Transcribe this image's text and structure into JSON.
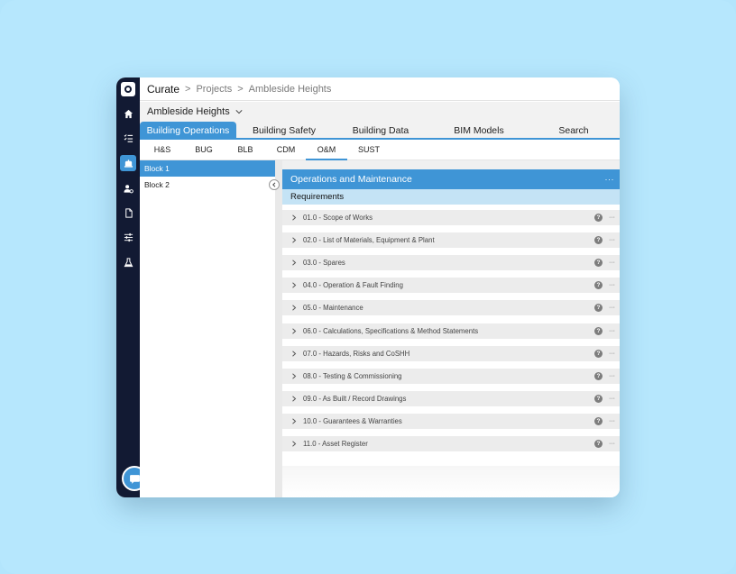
{
  "breadcrumb": {
    "app": "Curate",
    "separator": ">",
    "items": [
      "Projects",
      "Ambleside Heights"
    ]
  },
  "project": {
    "name": "Ambleside Heights"
  },
  "main_tabs": [
    {
      "label": "Building Operations",
      "active": true
    },
    {
      "label": "Building Safety",
      "active": false
    },
    {
      "label": "Building Data",
      "active": false
    },
    {
      "label": "BIM Models",
      "active": false
    },
    {
      "label": "Search",
      "active": false
    }
  ],
  "sub_tabs": [
    {
      "label": "H&S",
      "active": false
    },
    {
      "label": "BUG",
      "active": false
    },
    {
      "label": "BLB",
      "active": false
    },
    {
      "label": "CDM",
      "active": false
    },
    {
      "label": "O&M",
      "active": true
    },
    {
      "label": "SUST",
      "active": false
    }
  ],
  "blocks": [
    {
      "label": "Block 1",
      "active": true
    },
    {
      "label": "Block 2",
      "active": false
    }
  ],
  "panel": {
    "title": "Operations and Maintenance",
    "more": "···",
    "section": "Requirements"
  },
  "requirements": [
    {
      "label": "01.0 - Scope of Works"
    },
    {
      "label": "02.0 - List of Materials, Equipment & Plant"
    },
    {
      "label": "03.0 - Spares"
    },
    {
      "label": "04.0 - Operation & Fault Finding"
    },
    {
      "label": "05.0 - Maintenance"
    },
    {
      "label": "06.0 - Calculations, Specifications & Method Statements"
    },
    {
      "label": "07.0 - Hazards, Risks and CoSHH"
    },
    {
      "label": "08.0 - Testing & Commissioning"
    },
    {
      "label": "09.0 - As Built / Record Drawings"
    },
    {
      "label": "10.0 - Guarantees & Warranties"
    },
    {
      "label": "11.0 - Asset Register"
    }
  ],
  "row_help_glyph": "?",
  "row_more_glyph": "···",
  "colors": {
    "accent": "#3f95d6",
    "rail": "#121a33",
    "requirements_header": "#c4e3f5",
    "row": "#ececec"
  },
  "rail_icons": [
    "logo-icon",
    "home-icon",
    "checklist-icon",
    "building-icon",
    "user-settings-icon",
    "document-icon",
    "sliders-icon",
    "flask-icon"
  ]
}
